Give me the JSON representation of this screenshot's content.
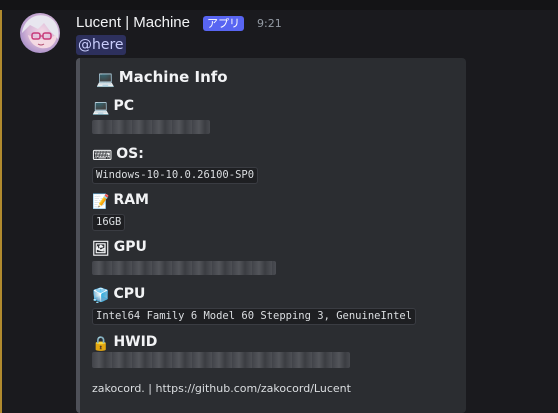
{
  "message": {
    "author": "Lucent | Machine",
    "badge": "アプリ",
    "time": "9:21",
    "mention": "@here"
  },
  "embed": {
    "title": "Machine Info",
    "title_emoji": "💻",
    "fields": {
      "pc": {
        "emoji": "💻",
        "name": "PC"
      },
      "os": {
        "emoji": "⌨",
        "name": "OS:",
        "value": "Windows-10-10.0.26100-SP0"
      },
      "ram": {
        "emoji": "📝",
        "name": "RAM",
        "value": "16GB"
      },
      "gpu": {
        "emoji": "🖼",
        "name": "GPU"
      },
      "cpu": {
        "emoji": "🧊",
        "name": "CPU",
        "value": "Intel64 Family 6 Model 60 Stepping 3, GenuineIntel"
      },
      "hwid": {
        "emoji": "🔒",
        "name": "HWID"
      }
    },
    "footer": "zakocord. | https://github.com/zakocord/Lucent"
  },
  "colors": {
    "background": "#1a1a1e",
    "embed_bg": "#2b2d31",
    "badge": "#5865f2",
    "mention_bar": "#b08a2e"
  }
}
